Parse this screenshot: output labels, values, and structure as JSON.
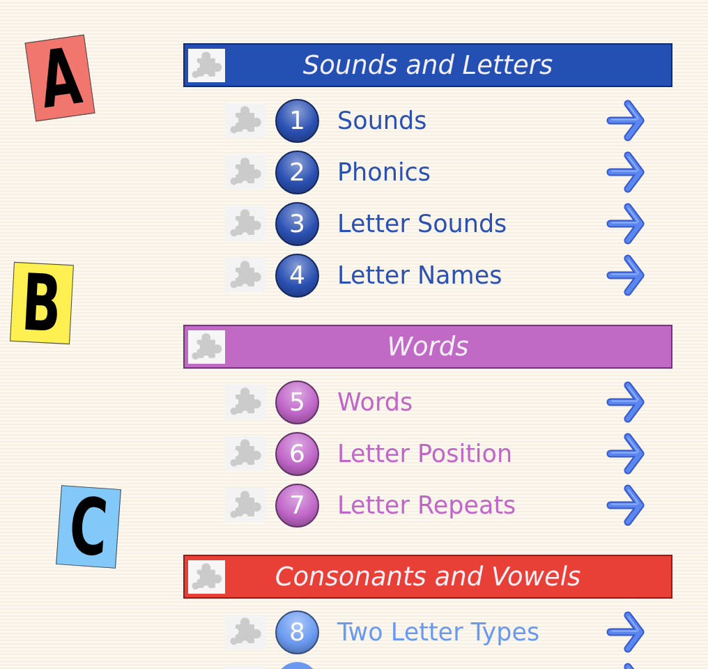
{
  "letter_tiles": [
    {
      "letter": "A",
      "color": "#f0766e"
    },
    {
      "letter": "B",
      "color": "#fdf050"
    },
    {
      "letter": "C",
      "color": "#82c8f8"
    }
  ],
  "sections": [
    {
      "title": "Sounds and Letters",
      "color": "#2450b4",
      "lessons": [
        {
          "kind": "lesson",
          "number": "1",
          "label": "Sounds",
          "color": "#2a50b2"
        },
        {
          "kind": "lesson",
          "number": "2",
          "label": "Phonics",
          "color": "#2a50b2"
        },
        {
          "kind": "lesson",
          "number": "3",
          "label": "Letter Sounds",
          "color": "#2a50b2"
        },
        {
          "kind": "lesson",
          "number": "4",
          "label": "Letter Names",
          "color": "#2a50b2"
        }
      ]
    },
    {
      "title": "Words",
      "color": "#c06ac6",
      "lessons": [
        {
          "kind": "lesson",
          "number": "5",
          "label": "Words",
          "color": "#c066c8"
        },
        {
          "kind": "lesson",
          "number": "6",
          "label": "Letter Position",
          "color": "#c066c8"
        },
        {
          "kind": "lesson",
          "number": "7",
          "label": "Letter Repeats",
          "color": "#c066c8"
        }
      ]
    },
    {
      "title": "Consonants and Vowels",
      "color": "#e84036",
      "lessons": [
        {
          "kind": "lesson",
          "number": "8",
          "label": "Two Letter Types",
          "color": "#6a9af0"
        },
        {
          "kind": "cut_off",
          "color": "#6a9af0"
        }
      ]
    }
  ]
}
